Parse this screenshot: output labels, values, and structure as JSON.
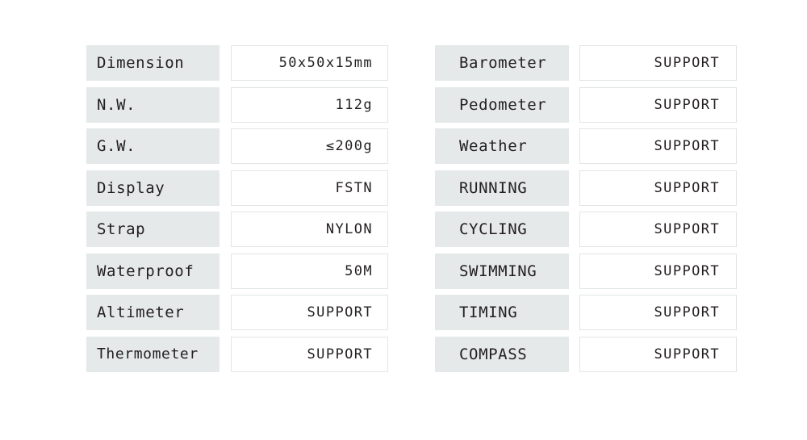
{
  "theme": {
    "label_background": "#e5e9e9",
    "value_background": "#ffffff",
    "value_border": "#e3e6e6",
    "text_color": "#231f20",
    "page_background": "#ffffff"
  },
  "spec_table": {
    "columns": [
      {
        "id": "hardware",
        "rows": [
          {
            "label": "Dimension",
            "value": "50x50x15mm"
          },
          {
            "label": "N.W.",
            "value": "112g"
          },
          {
            "label": "G.W.",
            "value": "≤200g"
          },
          {
            "label": "Display",
            "value": "FSTN"
          },
          {
            "label": "Strap",
            "value": "NYLON"
          },
          {
            "label": "Waterproof",
            "value": "50M"
          },
          {
            "label": "Altimeter",
            "value": "SUPPORT"
          },
          {
            "label": "Thermometer",
            "value": "SUPPORT"
          }
        ]
      },
      {
        "id": "features",
        "rows": [
          {
            "label": "Barometer",
            "value": "SUPPORT"
          },
          {
            "label": "Pedometer",
            "value": "SUPPORT"
          },
          {
            "label": "Weather",
            "value": "SUPPORT"
          },
          {
            "label": "RUNNING",
            "value": "SUPPORT"
          },
          {
            "label": "CYCLING",
            "value": "SUPPORT"
          },
          {
            "label": "SWIMMING",
            "value": "SUPPORT"
          },
          {
            "label": "TIMING",
            "value": "SUPPORT"
          },
          {
            "label": "COMPASS",
            "value": "SUPPORT"
          }
        ]
      }
    ]
  }
}
